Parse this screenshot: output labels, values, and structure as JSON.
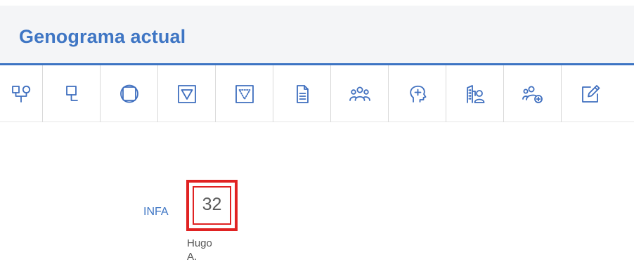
{
  "header": {
    "title": "Genograma actual"
  },
  "toolbar": {
    "tools": [
      {
        "icon": "family-tree-icon"
      },
      {
        "icon": "single-node-icon"
      },
      {
        "icon": "circle-square-icon"
      },
      {
        "icon": "triangle-box-icon"
      },
      {
        "icon": "dotted-triangle-box-icon"
      },
      {
        "icon": "document-icon"
      },
      {
        "icon": "group-people-icon"
      },
      {
        "icon": "head-plus-icon"
      },
      {
        "icon": "building-person-icon"
      },
      {
        "icon": "add-person-icon"
      },
      {
        "icon": "edit-icon"
      }
    ]
  },
  "node": {
    "side_label": "INFA",
    "age": "32",
    "name_line1": "Hugo",
    "name_line2": "A.",
    "accent_color": "#e02222"
  },
  "colors": {
    "brand": "#3f76c4",
    "icon": "#3f6fbf",
    "header_bg": "#f4f5f7"
  }
}
